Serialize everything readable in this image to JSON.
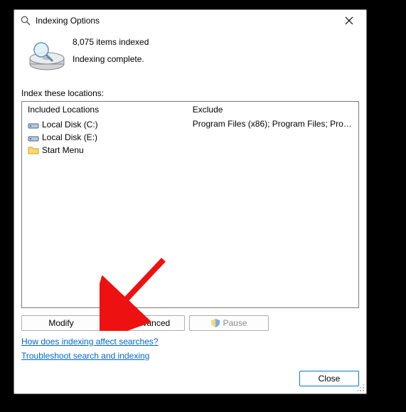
{
  "window": {
    "title": "Indexing Options"
  },
  "status": {
    "items_indexed": "8,075 items indexed",
    "state": "Indexing complete."
  },
  "section_label": "Index these locations:",
  "columns": {
    "included": "Included Locations",
    "exclude": "Exclude"
  },
  "locations": [
    {
      "icon": "drive",
      "label": "Local Disk (C:)",
      "exclude": "Program Files (x86); Program Files; Progra..."
    },
    {
      "icon": "drive",
      "label": "Local Disk (E:)",
      "exclude": ""
    },
    {
      "icon": "folder",
      "label": "Start Menu",
      "exclude": ""
    }
  ],
  "buttons": {
    "modify": "Modify",
    "advanced": "Advanced",
    "pause": "Pause",
    "close": "Close"
  },
  "links": {
    "how": "How does indexing affect searches?",
    "troubleshoot": "Troubleshoot search and indexing"
  }
}
